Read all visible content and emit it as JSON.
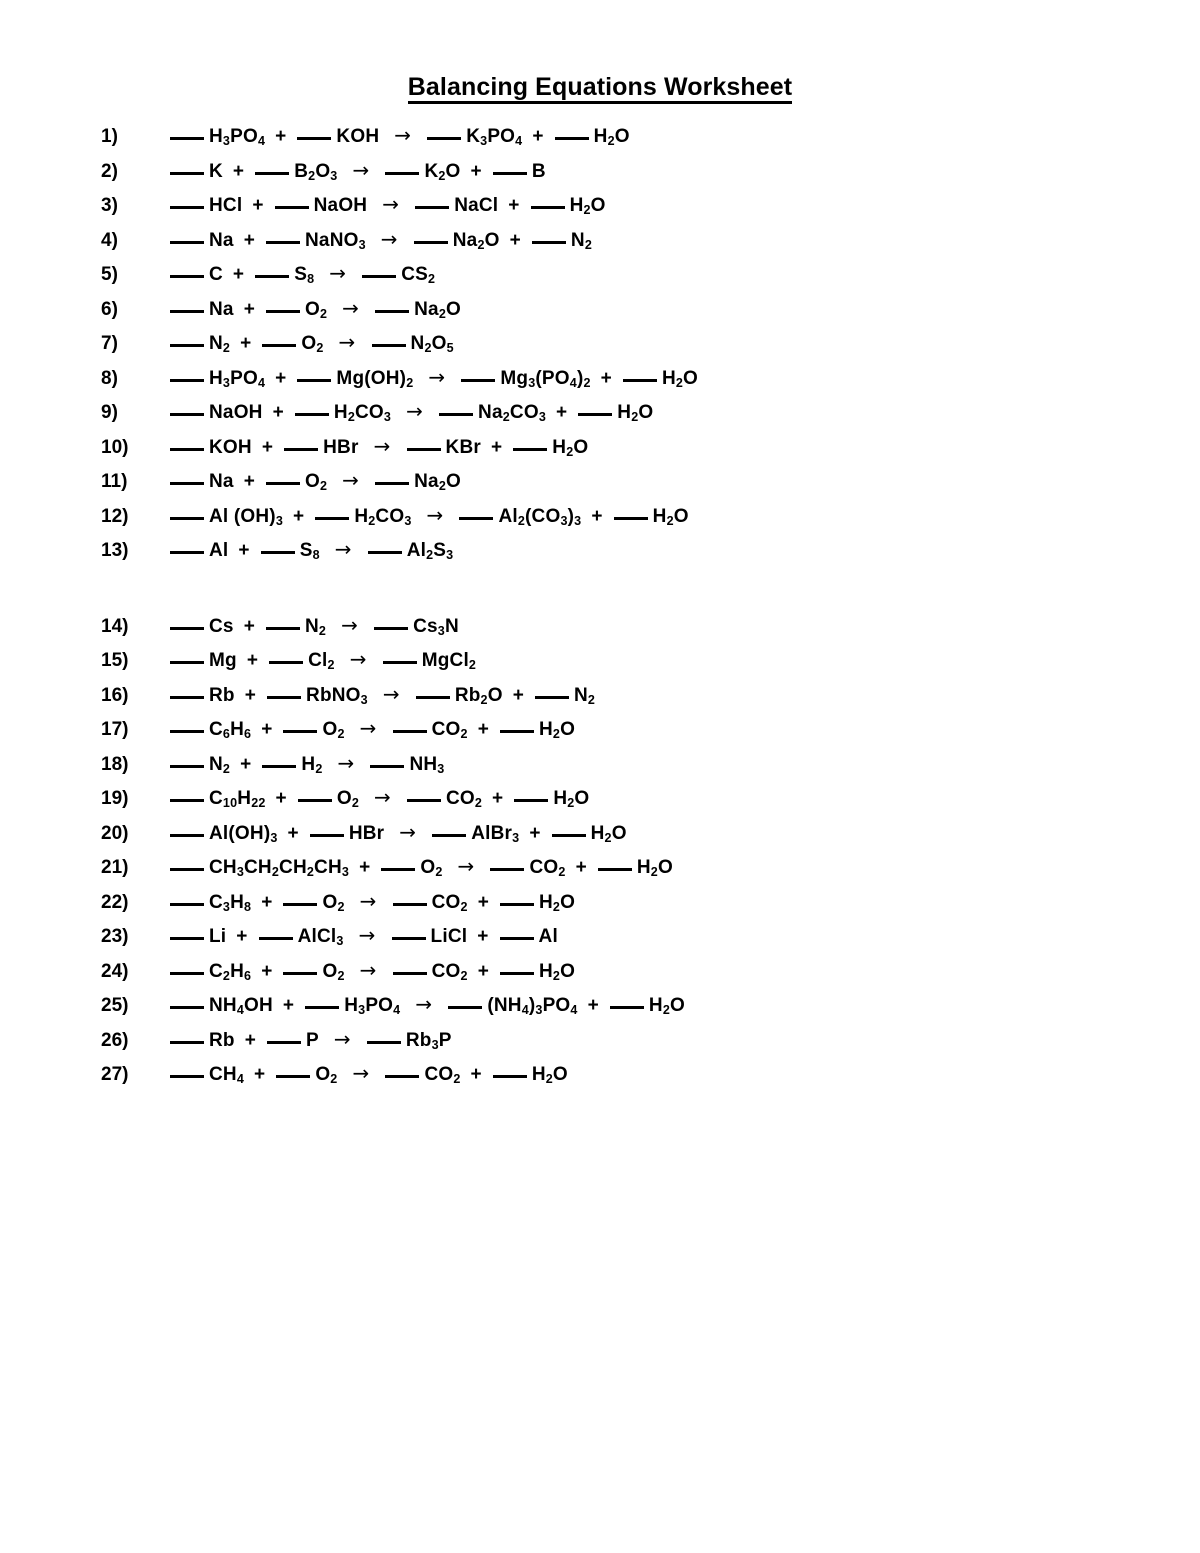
{
  "document": {
    "title": "Balancing Equations Worksheet",
    "arrow_glyph": "→",
    "plus_glyph": "+",
    "blank_glyph": "___",
    "text_color": "#000000",
    "background_color": "#ffffff"
  },
  "equations": [
    {
      "number": "1)",
      "text": "___ H3PO4  +  ___ KOH  →  ___ K3PO4  +  ___ H2O",
      "reactants": [
        "H3PO4",
        "KOH"
      ],
      "products": [
        "K3PO4",
        "H2O"
      ]
    },
    {
      "number": "2)",
      "text": "___ K  +  ___ B2O3  →  ___ K2O  +  ___ B",
      "reactants": [
        "K",
        "B2O3"
      ],
      "products": [
        "K2O",
        "B"
      ]
    },
    {
      "number": "3)",
      "text": "___ HCl  +  ___ NaOH  →  ___ NaCl  +  ___ H2O",
      "reactants": [
        "HCl",
        "NaOH"
      ],
      "products": [
        "NaCl",
        "H2O"
      ]
    },
    {
      "number": "4)",
      "text": "___ Na  +  ___ NaNO3  →  ___ Na2O  +  ___ N2",
      "reactants": [
        "Na",
        "NaNO3"
      ],
      "products": [
        "Na2O",
        "N2"
      ]
    },
    {
      "number": "5)",
      "text": "___ C  +  ___ S8  →  ___ CS2",
      "reactants": [
        "C",
        "S8"
      ],
      "products": [
        "CS2"
      ]
    },
    {
      "number": "6)",
      "text": "___ Na  +  ___ O2  →  ___ Na2O",
      "reactants": [
        "Na",
        "O2"
      ],
      "products": [
        "Na2O"
      ]
    },
    {
      "number": "7)",
      "text": "___ N2  +  ___ O2  →  ___ N2O5",
      "reactants": [
        "N2",
        "O2"
      ],
      "products": [
        "N2O5"
      ]
    },
    {
      "number": "8)",
      "text": "___ H3PO4  +  ___ Mg(OH)2  →  ___ Mg3(PO4)2  +  ___ H2O",
      "reactants": [
        "H3PO4",
        "Mg(OH)2"
      ],
      "products": [
        "Mg3(PO4)2",
        "H2O"
      ]
    },
    {
      "number": "9)",
      "text": "___ NaOH  +  ___ H2CO3  →  ___ Na2CO3  +  ___ H2O",
      "reactants": [
        "NaOH",
        "H2CO3"
      ],
      "products": [
        "Na2CO3",
        "H2O"
      ]
    },
    {
      "number": "10)",
      "text": "___ KOH  +  ___ HBr  →  ___ KBr  +  ___ H2O",
      "reactants": [
        "KOH",
        "HBr"
      ],
      "products": [
        "KBr",
        "H2O"
      ]
    },
    {
      "number": "11)",
      "text": "___ Na  +  ___ O2  →  ___ Na2O",
      "reactants": [
        "Na",
        "O2"
      ],
      "products": [
        "Na2O"
      ]
    },
    {
      "number": "12)",
      "text": "___ Al (OH)3  +  ___ H2CO3  →  ___ Al2(CO3)3  +  ___ H2O",
      "reactants": [
        "Al (OH)3",
        "H2CO3"
      ],
      "products": [
        "Al2(CO3)3",
        "H2O"
      ]
    },
    {
      "number": "13)",
      "text": "___ Al  +  ___ S8  →  ___ Al2S3",
      "reactants": [
        "Al",
        "S8"
      ],
      "products": [
        "Al2S3"
      ]
    },
    {
      "number": "14)",
      "text": "___ Cs  +  ___ N2  →  ___ Cs3N",
      "reactants": [
        "Cs",
        "N2"
      ],
      "products": [
        "Cs3N"
      ]
    },
    {
      "number": "15)",
      "text": "___ Mg  +  ___ Cl2  →  ___ MgCl2",
      "reactants": [
        "Mg",
        "Cl2"
      ],
      "products": [
        "MgCl2"
      ]
    },
    {
      "number": "16)",
      "text": "___ Rb  +  ___ RbNO3  →  ___ Rb2O  +  ___ N2",
      "reactants": [
        "Rb",
        "RbNO3"
      ],
      "products": [
        "Rb2O",
        "N2"
      ]
    },
    {
      "number": "17)",
      "text": "___ C6H6  +  ___ O2  →  ___ CO2  +  ___ H2O",
      "reactants": [
        "C6H6",
        "O2"
      ],
      "products": [
        "CO2",
        "H2O"
      ]
    },
    {
      "number": "18)",
      "text": "___ N2  +  ___ H2  →  ___ NH3",
      "reactants": [
        "N2",
        "H2"
      ],
      "products": [
        "NH3"
      ]
    },
    {
      "number": "19)",
      "text": "___ C10H22  +  ___ O2  →  ___ CO2  +  ___ H2O",
      "reactants": [
        "C10H22",
        "O2"
      ],
      "products": [
        "CO2",
        "H2O"
      ]
    },
    {
      "number": "20)",
      "text": "___ Al(OH)3  +  ___ HBr  →  ___ AlBr3  +  ___ H2O",
      "reactants": [
        "Al(OH)3",
        "HBr"
      ],
      "products": [
        "AlBr3",
        "H2O"
      ]
    },
    {
      "number": "21)",
      "text": "___ CH3CH2CH2CH3  +  ___ O2  →  ___ CO2  +  ___ H2O",
      "reactants": [
        "CH3CH2CH2CH3",
        "O2"
      ],
      "products": [
        "CO2",
        "H2O"
      ]
    },
    {
      "number": "22)",
      "text": "___ C3H8  +  ___ O2  →  ___ CO2  +  ___ H2O",
      "reactants": [
        "C3H8",
        "O2"
      ],
      "products": [
        "CO2",
        "H2O"
      ]
    },
    {
      "number": "23)",
      "text": "___ Li  +  ___ AlCl3  →  ___ LiCl  +  ___ Al",
      "reactants": [
        "Li",
        "AlCl3"
      ],
      "products": [
        "LiCl",
        "Al"
      ]
    },
    {
      "number": "24)",
      "text": "___ C2H6  +  ___ O2  →  ___ CO2  +  ___ H2O",
      "reactants": [
        "C2H6",
        "O2"
      ],
      "products": [
        "CO2",
        "H2O"
      ]
    },
    {
      "number": "25)",
      "text": "___ NH4OH  +  ___ H3PO4  →  ___ (NH4)3PO4  +  ___ H2O",
      "reactants": [
        "NH4OH",
        "H3PO4"
      ],
      "products": [
        "(NH4)3PO4",
        "H2O"
      ]
    },
    {
      "number": "26)",
      "text": "___ Rb  +  ___ P  →  ___ Rb3P",
      "reactants": [
        "Rb",
        "P"
      ],
      "products": [
        "Rb3P"
      ]
    },
    {
      "number": "27)",
      "text": "___ CH4  +  ___ O2  →  ___ CO2  +  ___ H2O",
      "reactants": [
        "CH4",
        "O2"
      ],
      "products": [
        "CO2",
        "H2O"
      ]
    }
  ],
  "layout": {
    "group_break_after_equation": 13,
    "total_equations": 27
  }
}
